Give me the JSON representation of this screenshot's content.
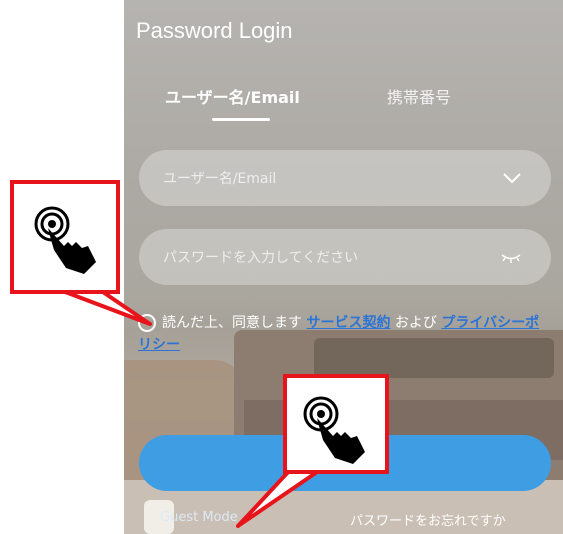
{
  "page": {
    "title": "Password Login"
  },
  "tabs": [
    {
      "label": "ユーザー名/Email",
      "active": true
    },
    {
      "label": "携帯番号",
      "active": false
    }
  ],
  "form": {
    "username_placeholder": "ユーザー名/Email",
    "password_placeholder": "パスワードを入力してください"
  },
  "consent": {
    "prefix": "読んだ上、同意します",
    "terms_link": "サービス契約",
    "middle": "および",
    "privacy_link": "プライバシーポリシー"
  },
  "footer": {
    "guest_mode": "Guest Mode",
    "forgot_password": "パスワードをお忘れですか"
  },
  "colors": {
    "accent": "#3f9ee3",
    "link": "#2b74d6",
    "callout": "#e8141b"
  },
  "icons": [
    "chevron-down-icon",
    "eye-closed-icon",
    "tap-hand-icon"
  ]
}
